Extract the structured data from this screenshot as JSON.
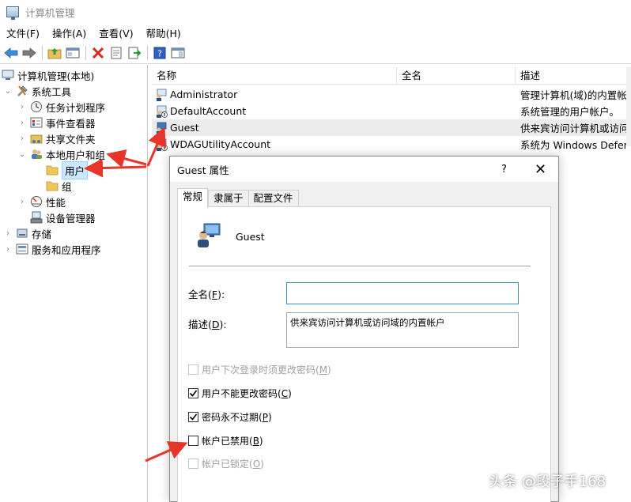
{
  "window": {
    "title": "计算机管理"
  },
  "menu": [
    "文件(F)",
    "操作(A)",
    "查看(V)",
    "帮助(H)"
  ],
  "tree": {
    "root": "计算机管理(本地)",
    "system_tools": "系统工具",
    "task_scheduler": "任务计划程序",
    "event_viewer": "事件查看器",
    "shared_folders": "共享文件夹",
    "local_users": "本地用户和组",
    "users": "用户",
    "groups": "组",
    "performance": "性能",
    "device_manager": "设备管理器",
    "storage": "存储",
    "services": "服务和应用程序"
  },
  "list": {
    "columns": [
      "名称",
      "全名",
      "描述"
    ],
    "rows": [
      {
        "name": "Administrator",
        "full": "",
        "desc": "管理计算机(域)的内置帐户"
      },
      {
        "name": "DefaultAccount",
        "full": "",
        "desc": "系统管理的用户帐户。"
      },
      {
        "name": "Guest",
        "full": "",
        "desc": "供来宾访问计算机或访问域的内置帐户"
      },
      {
        "name": "WDAGUtilityAccount",
        "full": "",
        "desc": "系统为 Windows Defender"
      }
    ]
  },
  "dialog": {
    "title": "Guest 属性",
    "help": "?",
    "close": "✕",
    "tabs": [
      "常规",
      "隶属于",
      "配置文件"
    ],
    "username": "Guest",
    "fullname_label_pre": "全名(",
    "fullname_label_key": "F",
    "fullname_label_post": "):",
    "fullname_value": "",
    "desc_label_pre": "描述(",
    "desc_label_key": "D",
    "desc_label_post": "):",
    "desc_value": "供来宾访问计算机或访问域的内置帐户",
    "checkboxes": [
      {
        "pre": "用户下次登录时须更改密码(",
        "key": "M",
        "post": ")",
        "checked": false,
        "disabled": true
      },
      {
        "pre": "用户不能更改密码(",
        "key": "C",
        "post": ")",
        "checked": true,
        "disabled": false
      },
      {
        "pre": "密码永不过期(",
        "key": "P",
        "post": ")",
        "checked": true,
        "disabled": false
      },
      {
        "pre": "帐户已禁用(",
        "key": "B",
        "post": ")",
        "checked": false,
        "disabled": false
      },
      {
        "pre": "帐户已锁定(",
        "key": "O",
        "post": ")",
        "checked": false,
        "disabled": true
      }
    ]
  },
  "watermark": "头条 @段子手168",
  "colors": {
    "arrow": "#e8352a",
    "selection": "#cce8ff",
    "focus": "#3d8ccf"
  }
}
